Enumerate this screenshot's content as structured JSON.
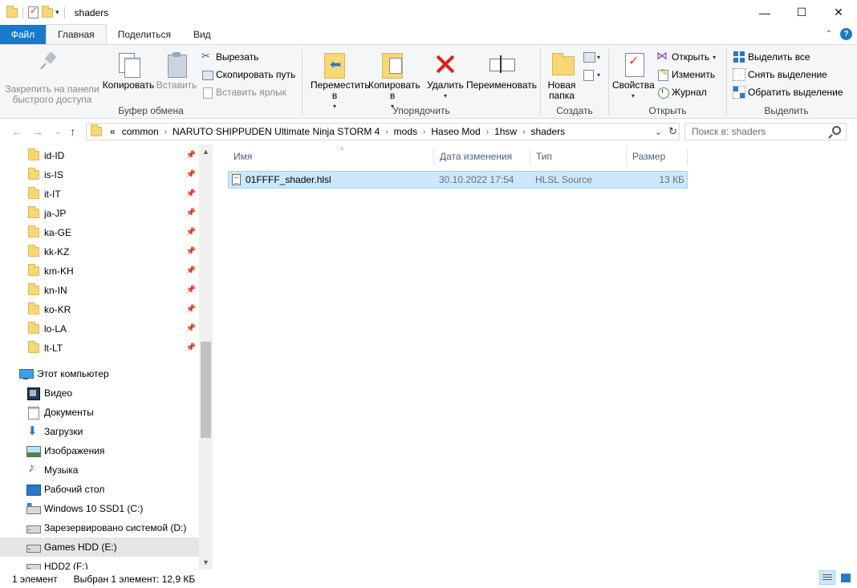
{
  "window": {
    "title": "shaders",
    "controls": {
      "minimize": "—",
      "maximize": "☐",
      "close": "✕"
    }
  },
  "ribbon_tabs": [
    "Файл",
    "Главная",
    "Поделиться",
    "Вид"
  ],
  "ribbon_help": "?",
  "ribbon": {
    "clipboard": {
      "label": "Буфер обмена",
      "pin": "Закрепить на панели быстрого доступа",
      "copy": "Копировать",
      "paste": "Вставить",
      "cut": "Вырезать",
      "copy_path": "Скопировать путь",
      "paste_shortcut": "Вставить ярлык"
    },
    "organize": {
      "label": "Упорядочить",
      "move": "Переместить в",
      "copy_to": "Копировать в",
      "delete": "Удалить",
      "rename": "Переименовать"
    },
    "new": {
      "label": "Создать",
      "new_folder": "Новая папка"
    },
    "open": {
      "label": "Открыть",
      "properties": "Свойства",
      "open": "Открыть",
      "edit": "Изменить",
      "history": "Журнал"
    },
    "select": {
      "label": "Выделить",
      "select_all": "Выделить все",
      "select_none": "Снять выделение",
      "invert": "Обратить выделение"
    }
  },
  "address": {
    "overflow": "«",
    "crumbs": [
      "common",
      "NARUTO SHIPPUDEN Ultimate Ninja STORM 4",
      "mods",
      "Haseo Mod",
      "1hsw",
      "shaders"
    ],
    "refresh": "↻"
  },
  "search": {
    "placeholder": "Поиск в: shaders"
  },
  "nav_pane": {
    "quick_folders": [
      "id-ID",
      "is-IS",
      "it-IT",
      "ja-JP",
      "ka-GE",
      "kk-KZ",
      "km-KH",
      "kn-IN",
      "ko-KR",
      "lo-LA",
      "lt-LT"
    ],
    "this_pc": "Этот компьютер",
    "pc_items": [
      {
        "label": "Видео",
        "icon": "video-icon"
      },
      {
        "label": "Документы",
        "icon": "documents-icon"
      },
      {
        "label": "Загрузки",
        "icon": "downloads-icon"
      },
      {
        "label": "Изображения",
        "icon": "pictures-icon"
      },
      {
        "label": "Музыка",
        "icon": "music-icon"
      },
      {
        "label": "Рабочий стол",
        "icon": "desktop-icon"
      },
      {
        "label": "Windows 10 SSD1 (C:)",
        "icon": "windows-drive-icon"
      },
      {
        "label": "Зарезервировано системой (D:)",
        "icon": "drive-icon"
      },
      {
        "label": "Games HDD (E:)",
        "icon": "drive-icon"
      },
      {
        "label": "HDD2 (F:)",
        "icon": "drive-icon"
      }
    ],
    "selected": "Games HDD (E:)"
  },
  "columns": [
    "Имя",
    "Дата изменения",
    "Тип",
    "Размер"
  ],
  "files": [
    {
      "name": "01FFFF_shader.hlsl",
      "modified": "30.10.2022 17:54",
      "type": "HLSL Source",
      "size": "13 КБ"
    }
  ],
  "status": {
    "count": "1 элемент",
    "selection": "Выбран 1 элемент: 12,9 КБ"
  },
  "colors": {
    "accent": "#1979ca",
    "selection_bg": "#cce8ff",
    "selection_border": "#99d1ff",
    "folder": "#f8d775"
  }
}
